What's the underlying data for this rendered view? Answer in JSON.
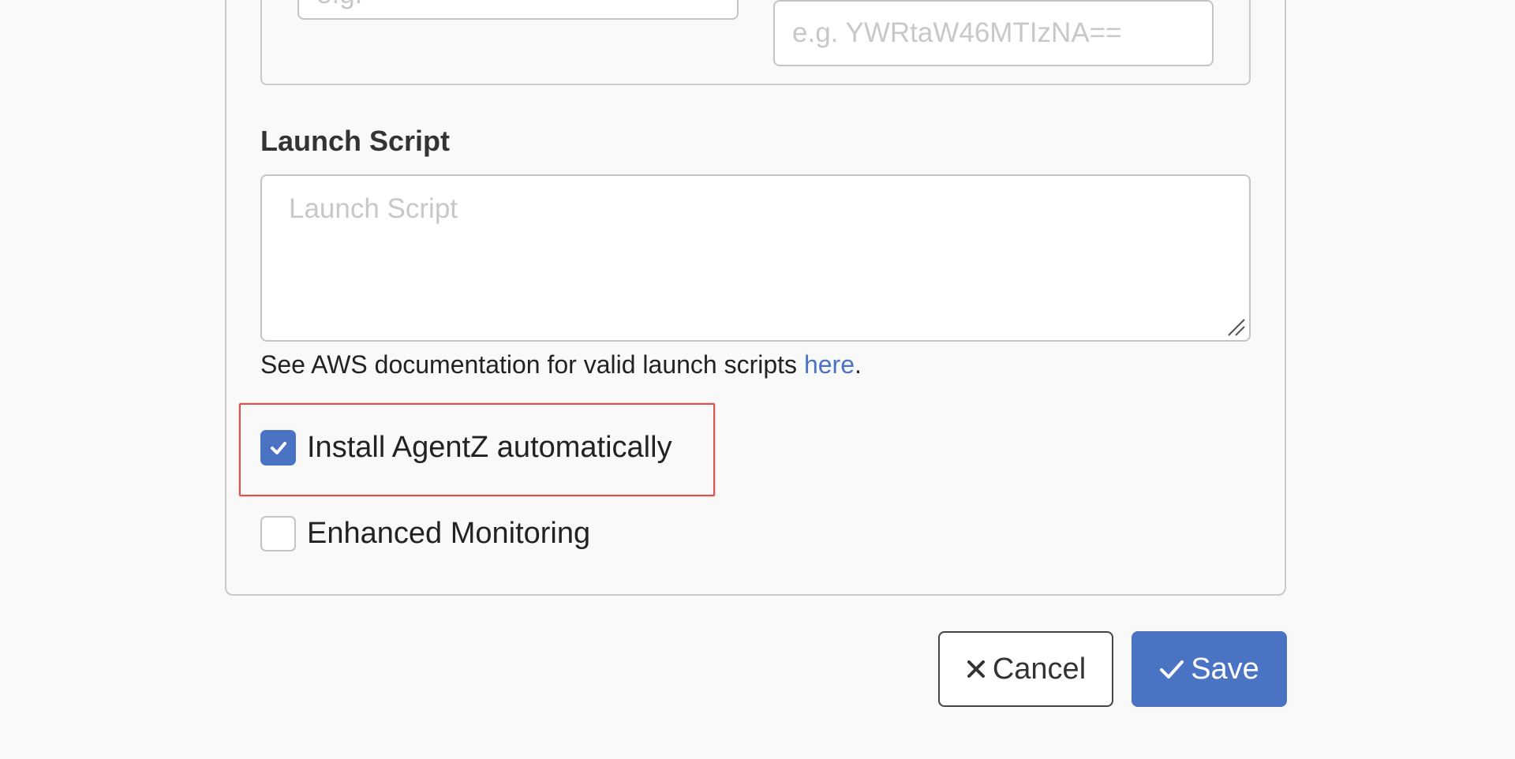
{
  "credentials": {
    "left_placeholder": "e.g.",
    "right_placeholder": "e.g. YWRtaW46MTIzNA=="
  },
  "launch_script": {
    "label": "Launch Script",
    "placeholder": "Launch Script",
    "help_prefix": "See AWS documentation for valid launch scripts ",
    "help_link": "here",
    "help_suffix": "."
  },
  "options": {
    "install_agent": {
      "label": "Install AgentZ automatically",
      "checked": true
    },
    "enhanced_monitoring": {
      "label": "Enhanced Monitoring",
      "checked": false
    }
  },
  "actions": {
    "cancel_label": "Cancel",
    "save_label": "Save"
  },
  "icons": {
    "cancel": "close-icon",
    "save": "check-icon",
    "checkbox_mark": "check-icon"
  },
  "colors": {
    "accent": "#4a73c4",
    "highlight": "#d9534f",
    "border": "#c4c4c4"
  }
}
